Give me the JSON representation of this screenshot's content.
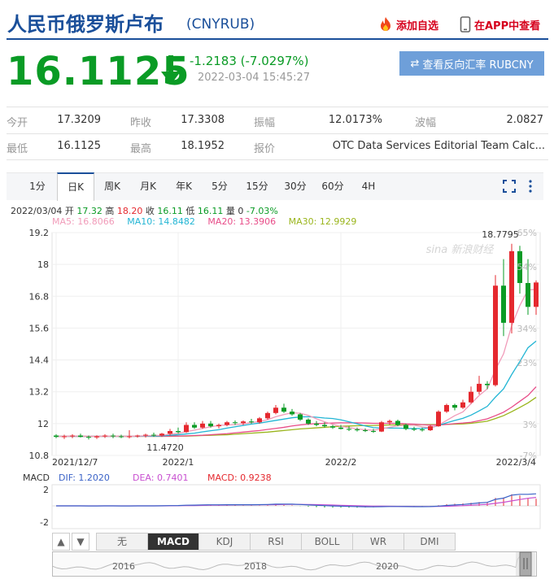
{
  "header": {
    "title": "人民币俄罗斯卢布",
    "code": "(CNYRUB)",
    "add_favorite": "添加自选",
    "view_in_app": "在APP中查看",
    "price": "16.1125",
    "change": "-1.2183 (-7.0297%)",
    "timestamp": "2022-03-04 15:45:27",
    "reverse_button": "查看反向汇率 RUBCNY",
    "down_color": "#0a9b25",
    "brand_color": "#1a4f9a"
  },
  "stats": {
    "row1": [
      {
        "label": "今开",
        "value": "17.3209"
      },
      {
        "label": "昨收",
        "value": "17.3308"
      },
      {
        "label": "振幅",
        "value": "12.0173%"
      },
      {
        "label": "波幅",
        "value": "2.0827"
      }
    ],
    "row2": [
      {
        "label": "最低",
        "value": "16.1125"
      },
      {
        "label": "最高",
        "value": "18.1952"
      },
      {
        "label": "报价",
        "value": "OTC Data Services Editorial Team Calc..."
      }
    ]
  },
  "tabs": [
    "1分",
    "日K",
    "周K",
    "月K",
    "年K",
    "5分",
    "15分",
    "30分",
    "60分",
    "4H"
  ],
  "active_tab": "日K",
  "info": {
    "ohlc": {
      "date": "2022/03/04",
      "open_label": "开",
      "open": "17.32",
      "high_label": "高",
      "high": "18.20",
      "close_label": "收",
      "close": "16.11",
      "low_label": "低",
      "low": "16.11",
      "vol_label": "量",
      "vol": "0",
      "pct": "-7.03%"
    },
    "ma": [
      {
        "label": "MA5: 16.8066",
        "color": "#f19bb9"
      },
      {
        "label": "MA10: 14.8482",
        "color": "#22b5d4"
      },
      {
        "label": "MA20: 13.3906",
        "color": "#e84c88"
      },
      {
        "label": "MA30: 12.9929",
        "color": "#9ab51c"
      }
    ]
  },
  "watermark": "sina 新浪财经",
  "macd_info": {
    "name": "MACD",
    "dif": "DIF: 1.2020",
    "dea": "DEA: 0.7401",
    "macd": "MACD: 0.9238"
  },
  "indicator_tabs": [
    "无",
    "MACD",
    "KDJ",
    "RSI",
    "BOLL",
    "WR",
    "DMI"
  ],
  "active_indicator": "MACD",
  "navigator_years": [
    "2016",
    "2018",
    "2020"
  ],
  "chart_data": {
    "type": "candlestick",
    "y_ticks": [
      "19.2",
      "18",
      "16.8",
      "15.6",
      "14.4",
      "13.2",
      "12",
      "10.8"
    ],
    "ylim": [
      10.8,
      19.2
    ],
    "pct_ticks": [
      "65%",
      "54%",
      "34%",
      "23%",
      "3%",
      "-7%"
    ],
    "x_ticks": [
      {
        "label": "2021/12/7",
        "index": 0
      },
      {
        "label": "2022/1",
        "index": 15
      },
      {
        "label": "2022/2",
        "index": 35
      },
      {
        "label": "2022/3/4",
        "index": 59
      }
    ],
    "annotations": {
      "max": "18.7795",
      "max_index": 56,
      "min": "11.4720",
      "min_index": 10
    },
    "candles": [
      [
        11.55,
        11.6,
        11.45,
        11.5
      ],
      [
        11.5,
        11.58,
        11.42,
        11.52
      ],
      [
        11.52,
        11.6,
        11.45,
        11.55
      ],
      [
        11.55,
        11.62,
        11.48,
        11.5
      ],
      [
        11.5,
        11.55,
        11.4,
        11.48
      ],
      [
        11.48,
        11.56,
        11.42,
        11.52
      ],
      [
        11.52,
        11.6,
        11.46,
        11.55
      ],
      [
        11.55,
        11.62,
        11.45,
        11.52
      ],
      [
        11.52,
        11.58,
        11.45,
        11.5
      ],
      [
        11.5,
        11.75,
        11.44,
        11.52
      ],
      [
        11.52,
        11.58,
        11.47,
        11.55
      ],
      [
        11.55,
        11.62,
        11.48,
        11.58
      ],
      [
        11.58,
        11.66,
        11.5,
        11.55
      ],
      [
        11.55,
        11.65,
        11.5,
        11.62
      ],
      [
        11.62,
        11.8,
        11.55,
        11.72
      ],
      [
        11.72,
        11.85,
        11.62,
        11.68
      ],
      [
        11.68,
        12.05,
        11.65,
        11.95
      ],
      [
        11.95,
        12.05,
        11.8,
        11.85
      ],
      [
        11.85,
        12.1,
        11.8,
        12.0
      ],
      [
        12.0,
        12.1,
        11.85,
        11.9
      ],
      [
        11.9,
        12.0,
        11.82,
        11.95
      ],
      [
        11.95,
        12.1,
        11.9,
        12.05
      ],
      [
        12.05,
        12.12,
        11.95,
        12.02
      ],
      [
        12.02,
        12.12,
        11.95,
        12.08
      ],
      [
        12.08,
        12.18,
        12.0,
        12.05
      ],
      [
        12.05,
        12.25,
        12.0,
        12.2
      ],
      [
        12.2,
        12.45,
        12.15,
        12.4
      ],
      [
        12.4,
        12.7,
        12.35,
        12.6
      ],
      [
        12.6,
        12.75,
        12.4,
        12.45
      ],
      [
        12.45,
        12.55,
        12.3,
        12.35
      ],
      [
        12.35,
        12.4,
        12.1,
        12.15
      ],
      [
        12.15,
        12.2,
        11.95,
        12.0
      ],
      [
        12.0,
        12.1,
        11.9,
        11.95
      ],
      [
        11.95,
        12.05,
        11.85,
        11.9
      ],
      [
        11.9,
        11.95,
        11.8,
        11.85
      ],
      [
        11.85,
        11.95,
        11.78,
        11.8
      ],
      [
        11.8,
        11.9,
        11.72,
        11.78
      ],
      [
        11.78,
        11.85,
        11.7,
        11.75
      ],
      [
        11.75,
        11.82,
        11.68,
        11.72
      ],
      [
        11.72,
        11.8,
        11.65,
        11.7
      ],
      [
        11.7,
        12.1,
        11.68,
        12.05
      ],
      [
        12.05,
        12.15,
        11.95,
        12.1
      ],
      [
        12.1,
        12.15,
        11.9,
        11.95
      ],
      [
        11.95,
        12.0,
        11.75,
        11.8
      ],
      [
        11.8,
        11.88,
        11.72,
        11.78
      ],
      [
        11.78,
        11.85,
        11.7,
        11.75
      ],
      [
        11.75,
        11.95,
        11.72,
        11.9
      ],
      [
        11.9,
        12.5,
        11.88,
        12.45
      ],
      [
        12.45,
        12.75,
        12.4,
        12.7
      ],
      [
        12.7,
        12.75,
        12.5,
        12.6
      ],
      [
        12.6,
        12.9,
        12.55,
        12.8
      ],
      [
        12.8,
        13.4,
        12.75,
        13.2
      ],
      [
        13.2,
        13.8,
        13.1,
        13.5
      ],
      [
        13.5,
        13.6,
        13.3,
        13.45
      ],
      [
        13.45,
        17.6,
        13.4,
        17.2
      ],
      [
        17.2,
        18.2,
        15.3,
        15.8
      ],
      [
        15.8,
        18.78,
        15.4,
        18.5
      ],
      [
        18.5,
        18.7,
        16.9,
        17.3
      ],
      [
        17.3,
        18.2,
        16.1,
        16.4
      ],
      [
        16.4,
        17.4,
        16.1,
        17.32
      ]
    ],
    "ma5": [
      11.52,
      11.52,
      11.53,
      11.53,
      11.52,
      11.52,
      11.52,
      11.53,
      11.52,
      11.52,
      11.53,
      11.54,
      11.55,
      11.56,
      11.6,
      11.63,
      11.7,
      11.75,
      11.82,
      11.88,
      11.93,
      11.95,
      11.96,
      11.99,
      12.04,
      12.08,
      12.15,
      12.26,
      12.34,
      12.41,
      12.39,
      12.31,
      12.18,
      12.07,
      11.97,
      11.9,
      11.85,
      11.8,
      11.77,
      11.75,
      11.8,
      11.86,
      11.92,
      11.94,
      11.94,
      11.88,
      11.84,
      11.94,
      12.12,
      12.3,
      12.44,
      12.75,
      13.06,
      13.31,
      14.03,
      14.63,
      15.69,
      16.45,
      17.04,
      17.06
    ],
    "ma10": [
      11.52,
      11.52,
      11.52,
      11.52,
      11.52,
      11.52,
      11.52,
      11.52,
      11.52,
      11.52,
      11.52,
      11.53,
      11.53,
      11.54,
      11.56,
      11.58,
      11.61,
      11.64,
      11.69,
      11.73,
      11.77,
      11.83,
      11.88,
      11.93,
      11.98,
      12.02,
      12.07,
      12.12,
      12.17,
      12.22,
      12.25,
      12.26,
      12.24,
      12.21,
      12.19,
      12.14,
      12.07,
      11.99,
      11.91,
      11.85,
      11.83,
      11.83,
      11.83,
      11.82,
      11.81,
      11.82,
      11.84,
      11.93,
      12.03,
      12.12,
      12.2,
      12.32,
      12.48,
      12.65,
      13.0,
      13.31,
      13.85,
      14.34,
      14.86,
      15.11
    ],
    "ma20": [
      11.52,
      11.52,
      11.52,
      11.52,
      11.52,
      11.52,
      11.52,
      11.52,
      11.52,
      11.52,
      11.52,
      11.52,
      11.52,
      11.52,
      11.53,
      11.53,
      11.54,
      11.55,
      11.56,
      11.58,
      11.6,
      11.62,
      11.65,
      11.68,
      11.71,
      11.74,
      11.78,
      11.82,
      11.86,
      11.91,
      11.95,
      11.98,
      12.0,
      12.01,
      12.02,
      12.03,
      12.03,
      12.03,
      12.02,
      12.01,
      12.01,
      12.01,
      12.01,
      11.99,
      11.98,
      11.96,
      11.94,
      11.95,
      11.97,
      12.0,
      12.02,
      12.05,
      12.11,
      12.18,
      12.3,
      12.43,
      12.62,
      12.84,
      13.06,
      13.39
    ],
    "ma30": [
      11.52,
      11.52,
      11.52,
      11.52,
      11.52,
      11.52,
      11.52,
      11.52,
      11.52,
      11.52,
      11.52,
      11.52,
      11.52,
      11.52,
      11.52,
      11.53,
      11.53,
      11.54,
      11.55,
      11.56,
      11.57,
      11.58,
      11.6,
      11.62,
      11.64,
      11.66,
      11.68,
      11.71,
      11.74,
      11.77,
      11.8,
      11.82,
      11.84,
      11.86,
      11.88,
      11.9,
      11.91,
      11.92,
      11.93,
      11.93,
      11.94,
      11.95,
      11.95,
      11.96,
      11.96,
      11.96,
      11.96,
      11.96,
      11.97,
      11.98,
      11.99,
      12.01,
      12.05,
      12.09,
      12.19,
      12.3,
      12.45,
      12.61,
      12.78,
      12.99
    ],
    "macd": {
      "y_ticks": [
        "2",
        "-2"
      ],
      "ylim": [
        -2.8,
        2.6
      ],
      "dif": [
        0,
        0,
        0,
        0,
        -0.01,
        -0.01,
        0,
        0,
        -0.01,
        -0.01,
        0,
        0,
        0,
        0.01,
        0.03,
        0.04,
        0.08,
        0.09,
        0.12,
        0.13,
        0.13,
        0.14,
        0.14,
        0.14,
        0.14,
        0.15,
        0.17,
        0.21,
        0.22,
        0.21,
        0.17,
        0.12,
        0.07,
        0.03,
        -0.01,
        -0.04,
        -0.07,
        -0.09,
        -0.11,
        -0.12,
        -0.1,
        -0.08,
        -0.08,
        -0.09,
        -0.1,
        -0.1,
        -0.09,
        -0.03,
        0.05,
        0.11,
        0.17,
        0.26,
        0.36,
        0.43,
        0.8,
        0.95,
        1.32,
        1.42,
        1.42,
        1.48
      ],
      "dea": [
        0,
        0,
        0,
        0,
        0,
        0,
        0,
        0,
        0,
        0,
        0,
        0,
        0,
        0,
        0.01,
        0.02,
        0.03,
        0.04,
        0.06,
        0.08,
        0.09,
        0.1,
        0.11,
        0.12,
        0.12,
        0.13,
        0.14,
        0.15,
        0.17,
        0.18,
        0.18,
        0.17,
        0.15,
        0.13,
        0.1,
        0.07,
        0.04,
        0.02,
        -0.01,
        -0.03,
        -0.04,
        -0.05,
        -0.06,
        -0.06,
        -0.07,
        -0.08,
        -0.08,
        -0.07,
        -0.05,
        -0.02,
        0.02,
        0.07,
        0.13,
        0.19,
        0.31,
        0.44,
        0.61,
        0.78,
        0.93,
        1.04
      ],
      "hist": [
        0,
        0,
        0,
        0,
        -0.02,
        -0.02,
        0,
        0,
        -0.02,
        -0.02,
        0,
        0,
        0,
        0.02,
        0.04,
        0.04,
        0.1,
        0.1,
        0.12,
        0.1,
        0.08,
        0.08,
        0.06,
        0.04,
        0.04,
        0.04,
        0.06,
        0.12,
        0.1,
        0.06,
        -0.02,
        -0.1,
        -0.16,
        -0.2,
        -0.22,
        -0.22,
        -0.22,
        -0.22,
        -0.2,
        -0.18,
        -0.12,
        -0.06,
        -0.04,
        -0.06,
        -0.06,
        -0.04,
        -0.02,
        0.08,
        0.2,
        0.26,
        0.3,
        0.38,
        0.46,
        0.48,
        0.98,
        1.02,
        1.42,
        1.28,
        0.98,
        0.88
      ]
    }
  }
}
